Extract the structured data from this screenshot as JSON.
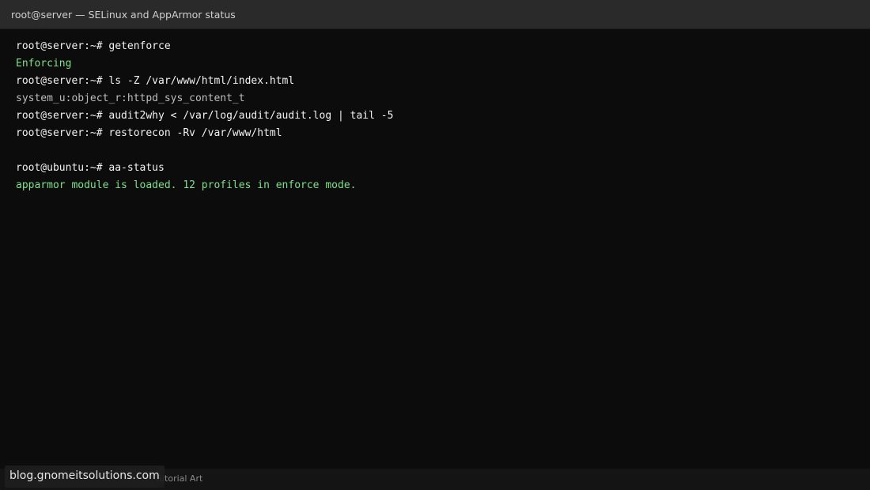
{
  "window": {
    "title": "root@server — SELinux and AppArmor status"
  },
  "terminal": {
    "lines": [
      {
        "text": "root@server:~# getenforce",
        "style": "white"
      },
      {
        "text": "Enforcing",
        "style": "green"
      },
      {
        "text": "root@server:~# ls -Z /var/www/html/index.html",
        "style": "white"
      },
      {
        "text": "system_u:object_r:httpd_sys_content_t",
        "style": "gray"
      },
      {
        "text": "root@server:~# audit2why < /var/log/audit/audit.log | tail -5",
        "style": "white"
      },
      {
        "text": "root@server:~# restorecon -Rv /var/www/html",
        "style": "white"
      },
      {
        "text": "",
        "style": "blank"
      },
      {
        "text": "root@ubuntu:~# aa-status",
        "style": "white"
      },
      {
        "text": "apparmor module is loaded. 12 profiles in enforce mode.",
        "style": "green"
      }
    ]
  },
  "footer": {
    "credit": "Tutorial Art",
    "watermark": "blog.gnomeitsolutions.com"
  },
  "colors": {
    "background": "#0c0c0c",
    "titlebar": "#2a2a2a",
    "success_green": "#7ee08a",
    "muted_gray": "#bdbdbd"
  }
}
